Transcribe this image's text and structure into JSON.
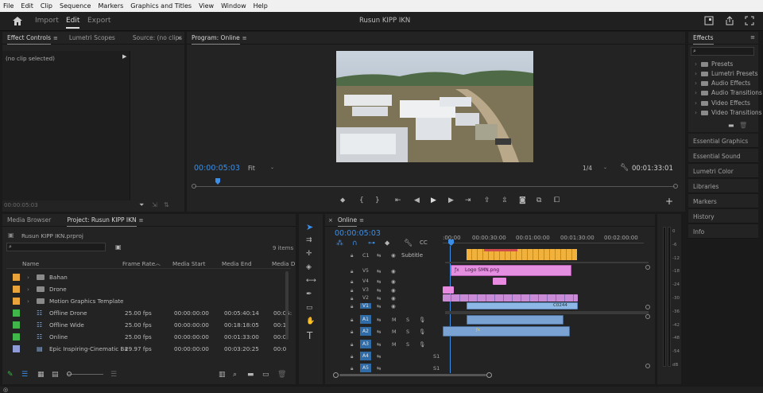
{
  "menu": [
    "File",
    "Edit",
    "Clip",
    "Sequence",
    "Markers",
    "Graphics and Titles",
    "View",
    "Window",
    "Help"
  ],
  "header": {
    "tabs": [
      "Import",
      "Edit",
      "Export"
    ],
    "project_title": "Rusun KIPP IKN"
  },
  "effect_controls": {
    "tabs": [
      "Effect Controls",
      "Lumetri Scopes",
      "Source: (no clips"
    ],
    "no_clip": "(no clip selected)",
    "timecode": "00:00:05:03"
  },
  "program": {
    "title": "Program: Online",
    "timecode": "00:00:05:03",
    "fit": "Fit",
    "resolution": "1/4",
    "duration": "00:01:33:01",
    "preview_desc": "aerial photo of residential buildings"
  },
  "effects": {
    "title": "Effects",
    "items": [
      "Presets",
      "Lumetri Presets",
      "Audio Effects",
      "Audio Transitions",
      "Video Effects",
      "Video Transitions"
    ],
    "sections": [
      "Essential Graphics",
      "Essential Sound",
      "Lumetri Color",
      "Libraries",
      "Markers",
      "History",
      "Info"
    ]
  },
  "project": {
    "tabs": [
      "Media Browser",
      "Project: Rusun KIPP IKN"
    ],
    "file": "Rusun KIPP IKN.prproj",
    "items_count": "9 items",
    "columns": [
      "Name",
      "Frame Rate",
      "Media Start",
      "Media End",
      "Media D"
    ],
    "rows": [
      {
        "name": "Bahan",
        "fps": "",
        "start": "",
        "end": "",
        "color": "#e8a33b",
        "type": "folder"
      },
      {
        "name": "Drone",
        "fps": "",
        "start": "",
        "end": "",
        "color": "#e8a33b",
        "type": "folder"
      },
      {
        "name": "Motion Graphics Template",
        "fps": "",
        "start": "",
        "end": "",
        "color": "#e8a33b",
        "type": "folder"
      },
      {
        "name": "Offline Drone",
        "fps": "25.00 fps",
        "start": "00:00:00:00",
        "end": "00:05:40:14",
        "color": "#3fb54a",
        "type": "seq"
      },
      {
        "name": "Offline Wide",
        "fps": "25.00 fps",
        "start": "00:00:00:00",
        "end": "00:18:18:05",
        "color": "#3fb54a",
        "type": "seq"
      },
      {
        "name": "Online",
        "fps": "25.00 fps",
        "start": "00:00:00:00",
        "end": "00:01:33:00",
        "color": "#3fb54a",
        "type": "seq"
      },
      {
        "name": "Epic Inspiring-Cinematic Ba",
        "fps": "29.97 fps",
        "start": "00:00:00:00",
        "end": "00:03:20:25",
        "color": "#8f9bd6",
        "type": "audio"
      }
    ],
    "end_cut": [
      "00:05:",
      "00:1",
      "00:0",
      "00:0"
    ]
  },
  "timeline": {
    "tab": "Online",
    "timecode": "00:00:05:03",
    "ruler": [
      ":00:00",
      "00:00:30:00",
      "00:01:00:00",
      "00:01:30:00",
      "00:02:00:00"
    ],
    "subtitle": "Subtitle",
    "c1": "C1",
    "video_tracks": [
      "V5",
      "V4",
      "V3",
      "V2",
      "V1"
    ],
    "audio_tracks": [
      "A1",
      "A2",
      "A3",
      "A4",
      "A5"
    ],
    "logo_clip": "Logo SMN.png",
    "v1_clip": "C0244",
    "s1": "S1",
    "m": "M",
    "s": "S"
  },
  "vu": {
    "ticks": [
      "0",
      "-6",
      "-12",
      "-18",
      "-24",
      "-30",
      "-36",
      "-42",
      "-48",
      "-54",
      "dB"
    ]
  }
}
